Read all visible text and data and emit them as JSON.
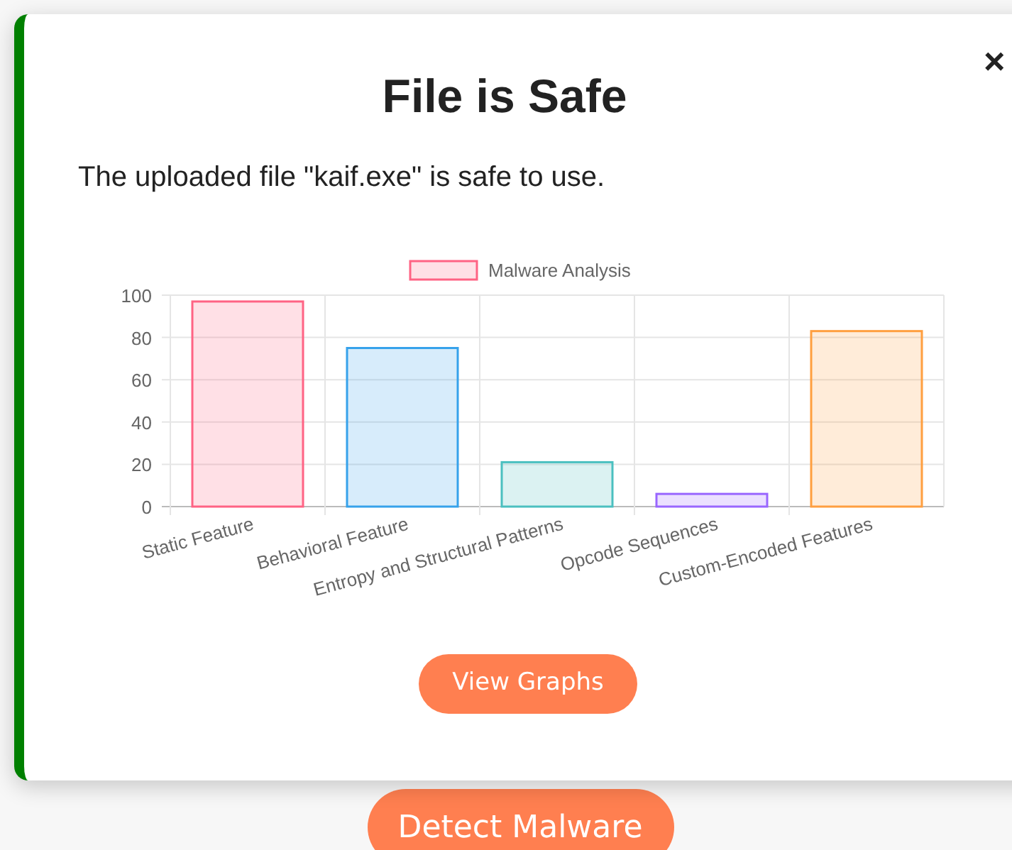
{
  "modal": {
    "title": "File is Safe",
    "close": "×",
    "message": "The uploaded file \"kaif.exe\" is safe to use.",
    "button": "View Graphs",
    "chart_data": {
      "type": "bar",
      "categories": [
        "Static Feature",
        "Behavioral Feature",
        "Entropy and Structural Patterns",
        "Opcode Sequences",
        "Custom-Encoded Features"
      ],
      "series": [
        {
          "name": "Malware Analysis",
          "values": [
            97,
            75,
            21,
            6,
            83
          ]
        }
      ],
      "ylim": [
        0,
        100
      ],
      "yticks": [
        0,
        20,
        40,
        60,
        80,
        100
      ],
      "grid": true
    },
    "bars": [
      {
        "color": "#ff6384"
      },
      {
        "color": "#36a2eb"
      },
      {
        "color": "#4bc0c0"
      },
      {
        "color": "#9966ff"
      },
      {
        "color": "#ff9f40"
      }
    ]
  },
  "page": {
    "button": "Detect Malware"
  }
}
